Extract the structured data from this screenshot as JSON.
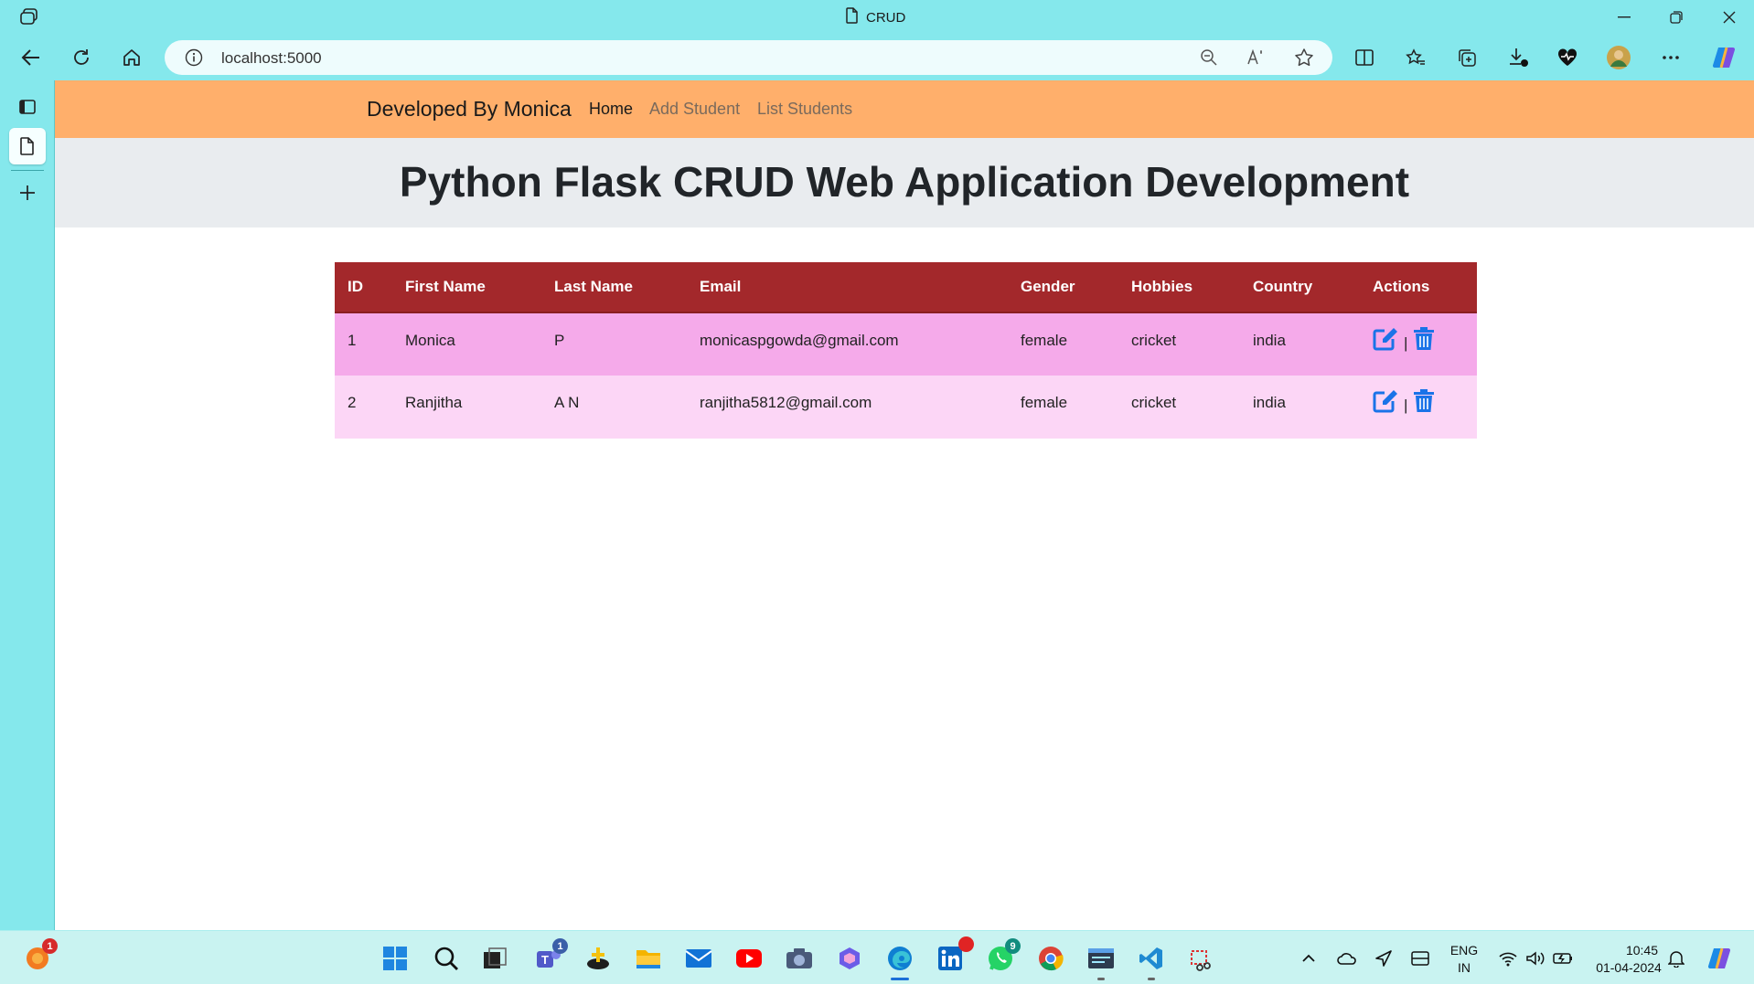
{
  "browser": {
    "tab_title": "CRUD",
    "address": "localhost:5000"
  },
  "navbar": {
    "brand": "Developed By Monica",
    "links": [
      "Home",
      "Add Student",
      "List Students"
    ]
  },
  "hero": {
    "title": "Python Flask CRUD Web Application Development"
  },
  "table": {
    "headers": [
      "ID",
      "First Name",
      "Last Name",
      "Email",
      "Gender",
      "Hobbies",
      "Country",
      "Actions"
    ],
    "rows": [
      {
        "id": "1",
        "first": "Monica",
        "last": "P",
        "email": "monicaspgowda@gmail.com",
        "gender": "female",
        "hobbies": "cricket",
        "country": "india"
      },
      {
        "id": "2",
        "first": "Ranjitha",
        "last": "A N",
        "email": "ranjitha5812@gmail.com",
        "gender": "female",
        "hobbies": "cricket",
        "country": "india"
      }
    ],
    "action_separator": "|"
  },
  "taskbar": {
    "badges": {
      "avatar": "1",
      "teams": "1",
      "whatsapp": "9"
    },
    "lang": "ENG",
    "region": "IN",
    "time": "10:45",
    "date": "01-04-2024"
  },
  "colors": {
    "navbar": "#ffaf6b",
    "table_header": "#a3282b",
    "row1": "#f5aaea",
    "row2": "#fcd6f6",
    "action_icon": "#1a73e8",
    "chrome": "#85e8ec"
  },
  "icons": [
    "workspaces-icon",
    "document-icon",
    "minimize-icon",
    "restore-icon",
    "close-icon",
    "back-icon",
    "refresh-icon",
    "home-icon",
    "info-icon",
    "zoom-out-icon",
    "read-aloud-icon",
    "favorite-star-icon",
    "split-screen-icon",
    "favorites-icon",
    "collections-icon",
    "downloads-icon",
    "browser-essentials-icon",
    "profile-avatar-icon",
    "more-icon",
    "copilot-icon",
    "tab-actions-icon",
    "new-tab-icon",
    "edit-icon",
    "delete-icon"
  ]
}
